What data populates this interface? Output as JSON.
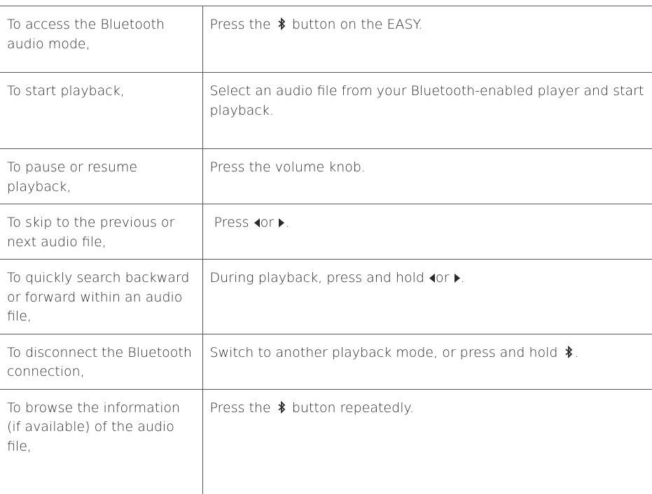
{
  "rows": [
    {
      "action": "To access the Bluetooth audio mode,",
      "instruction_before": "Press the",
      "instruction_after": "button on the EASY."
    },
    {
      "action": "To start playback,",
      "instruction": "Select an audio file from your Bluetooth-enabled player and start playback."
    },
    {
      "action": "To pause or resume playback,",
      "instruction": "Press the volume knob."
    },
    {
      "action": "To skip to the previous or next audio file,",
      "instruction_before": "Press",
      "instruction_middle": "or",
      "instruction_after": "."
    },
    {
      "action": "To quickly search backward or forward within an audio file,",
      "instruction_before": "During playback, press and hold",
      "instruction_middle": "or",
      "instruction_after": "."
    },
    {
      "action": "To disconnect the Bluetooth connection,",
      "instruction_before": "Switch to another playback mode, or press and hold",
      "instruction_after": "."
    },
    {
      "action": "To browse the information (if available) of the audio file,",
      "instruction_before": "Press the",
      "instruction_after": "button repeatedly."
    }
  ],
  "icons": {
    "bluetooth": "bluetooth-icon",
    "previous": "triangle-left-icon",
    "next": "triangle-right-icon"
  },
  "colors": {
    "text": "#2a2a2a",
    "rule": "#555555"
  }
}
